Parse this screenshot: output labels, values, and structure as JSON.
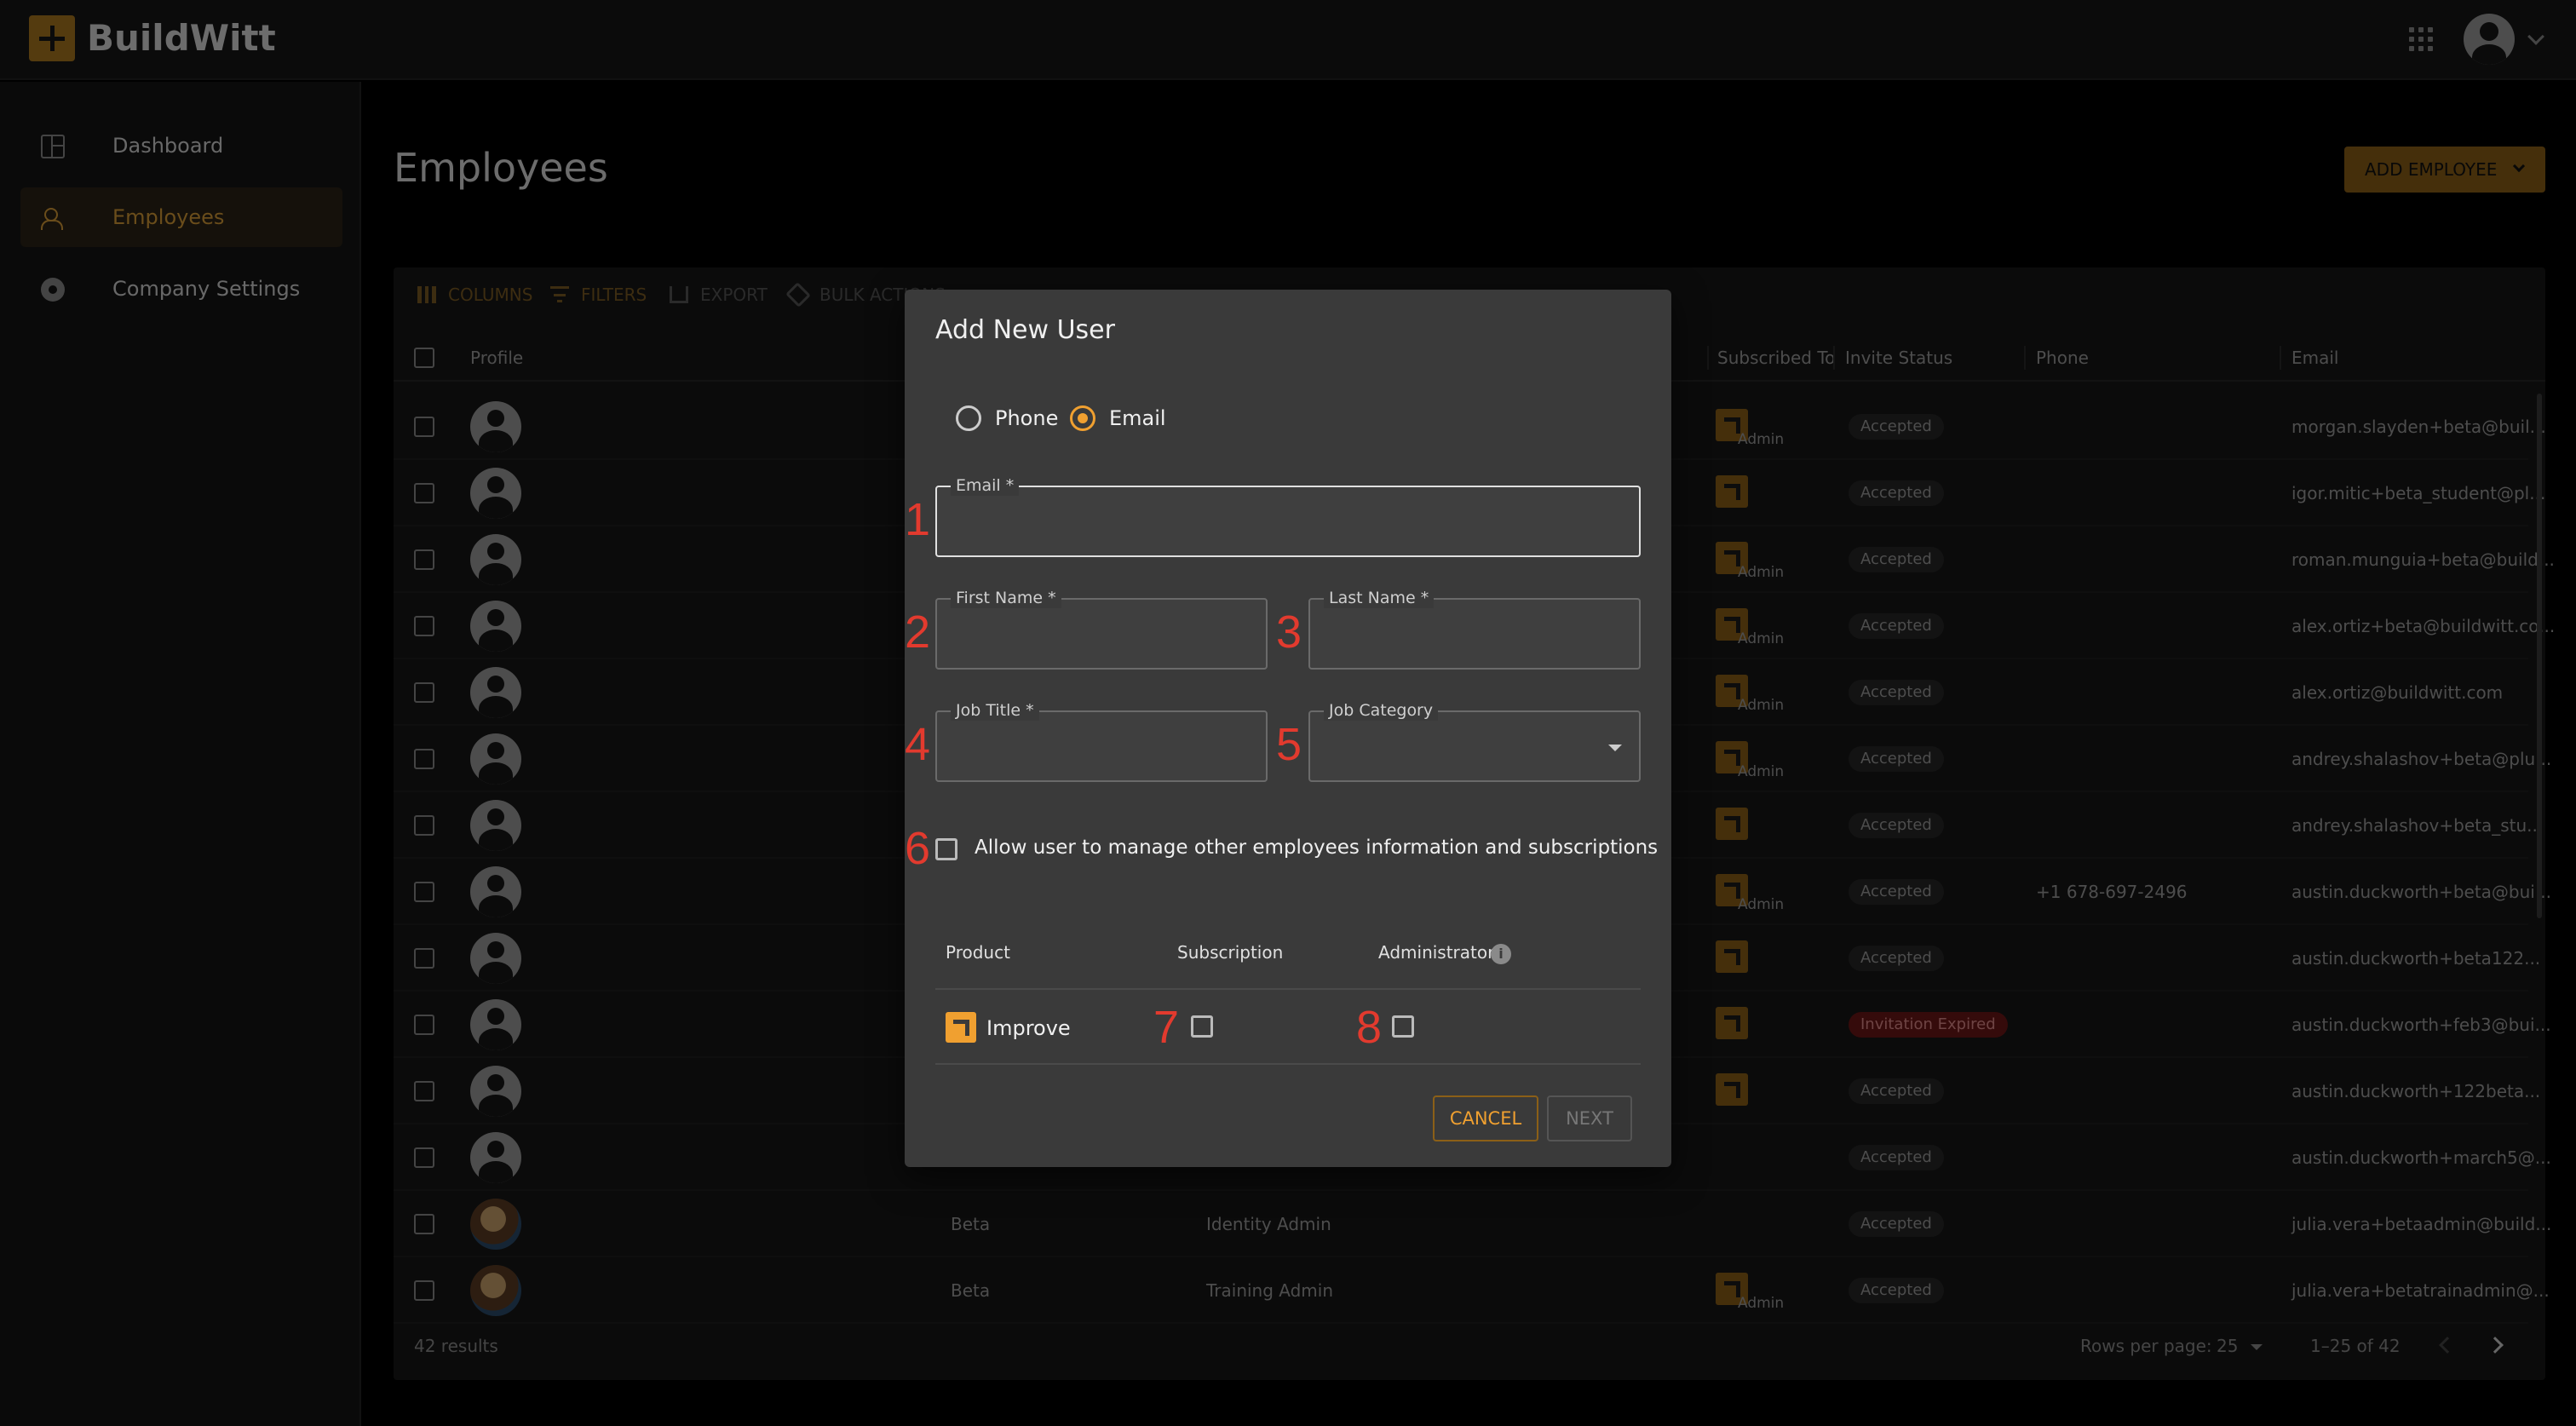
{
  "app": {
    "brand": "BuildWitt"
  },
  "sidebar": {
    "items": [
      {
        "label": "Dashboard",
        "icon": "dashboard-icon"
      },
      {
        "label": "Employees",
        "icon": "people-icon",
        "active": true
      },
      {
        "label": "Company Settings",
        "icon": "gear-icon"
      }
    ]
  },
  "page": {
    "title": "Employees",
    "add_button": "ADD EMPLOYEE"
  },
  "toolbar": {
    "columns": "COLUMNS",
    "filters": "FILTERS",
    "export": "EXPORT",
    "bulk": "BULK ACTIONS"
  },
  "table": {
    "headers": {
      "profile": "Profile",
      "subscribed": "Subscribed To",
      "invite": "Invite Status",
      "phone": "Phone",
      "email": "Email"
    },
    "rows": [
      {
        "first": "",
        "title": "",
        "admin": "Admin",
        "badge": true,
        "status": "Accepted",
        "phone": "",
        "email": "morgan.slayden+beta@buil..."
      },
      {
        "first": "",
        "title": "",
        "admin": "",
        "badge": true,
        "status": "Accepted",
        "phone": "",
        "email": "igor.mitic+beta_student@pl..."
      },
      {
        "first": "",
        "title": "",
        "admin": "Admin",
        "badge": true,
        "status": "Accepted",
        "phone": "",
        "email": "roman.munguia+beta@build..."
      },
      {
        "first": "",
        "title": "",
        "admin": "Admin",
        "badge": true,
        "status": "Accepted",
        "phone": "",
        "email": "alex.ortiz+beta@buildwitt.co..."
      },
      {
        "first": "",
        "title": "",
        "admin": "Admin",
        "badge": true,
        "status": "Accepted",
        "phone": "",
        "email": "alex.ortiz@buildwitt.com"
      },
      {
        "first": "",
        "title": "",
        "admin": "Admin",
        "badge": true,
        "status": "Accepted",
        "phone": "",
        "email": "andrey.shalashov+beta@plu..."
      },
      {
        "first": "",
        "title": "",
        "admin": "",
        "badge": true,
        "status": "Accepted",
        "phone": "",
        "email": "andrey.shalashov+beta_stu..."
      },
      {
        "first": "",
        "title": "",
        "admin": "Admin",
        "badge": true,
        "status": "Accepted",
        "phone": "+1 678-697-2496",
        "email": "austin.duckworth+beta@bui..."
      },
      {
        "first": "",
        "title": "",
        "admin": "",
        "badge": true,
        "status": "Accepted",
        "phone": "",
        "email": "austin.duckworth+beta122..."
      },
      {
        "first": "",
        "title": "",
        "admin": "",
        "badge": true,
        "status": "Invitation Expired",
        "phone": "",
        "email": "austin.duckworth+feb3@bui..."
      },
      {
        "first": "",
        "title": "",
        "admin": "",
        "badge": true,
        "status": "Accepted",
        "phone": "",
        "email": "austin.duckworth+122beta..."
      },
      {
        "first": "",
        "title": "",
        "admin": "",
        "badge": false,
        "status": "Accepted",
        "phone": "",
        "email": "austin.duckworth+march5@..."
      },
      {
        "first": "Beta",
        "title": "Identity Admin",
        "admin": "",
        "badge": false,
        "status": "Accepted",
        "phone": "",
        "email": "julia.vera+betaadmin@build..."
      },
      {
        "first": "Beta",
        "title": "Training Admin",
        "admin": "Admin",
        "badge": true,
        "status": "Accepted",
        "phone": "",
        "email": "julia.vera+betatrainadmin@..."
      }
    ]
  },
  "footer": {
    "results": "42 results",
    "rows_per_page_label": "Rows per page:",
    "rows_per_page": "25",
    "range": "1–25 of 42"
  },
  "dialog": {
    "title": "Add New User",
    "radio_phone": "Phone",
    "radio_email": "Email",
    "email_label": "Email *",
    "first_name_label": "First Name *",
    "last_name_label": "Last Name *",
    "job_title_label": "Job Title *",
    "job_category_label": "Job Category",
    "allow_label": "Allow user to manage other employees information and subscriptions",
    "col_product": "Product",
    "col_subscription": "Subscription",
    "col_admin": "Administrator",
    "product_name": "Improve",
    "cancel": "CANCEL",
    "next": "NEXT",
    "markers": [
      "1",
      "2",
      "3",
      "4",
      "5",
      "6",
      "7",
      "8"
    ]
  },
  "colors": {
    "accent": "#f0a030",
    "brand": "#a9761f",
    "expired": "#6a1616",
    "marker": "#e23a2e"
  }
}
